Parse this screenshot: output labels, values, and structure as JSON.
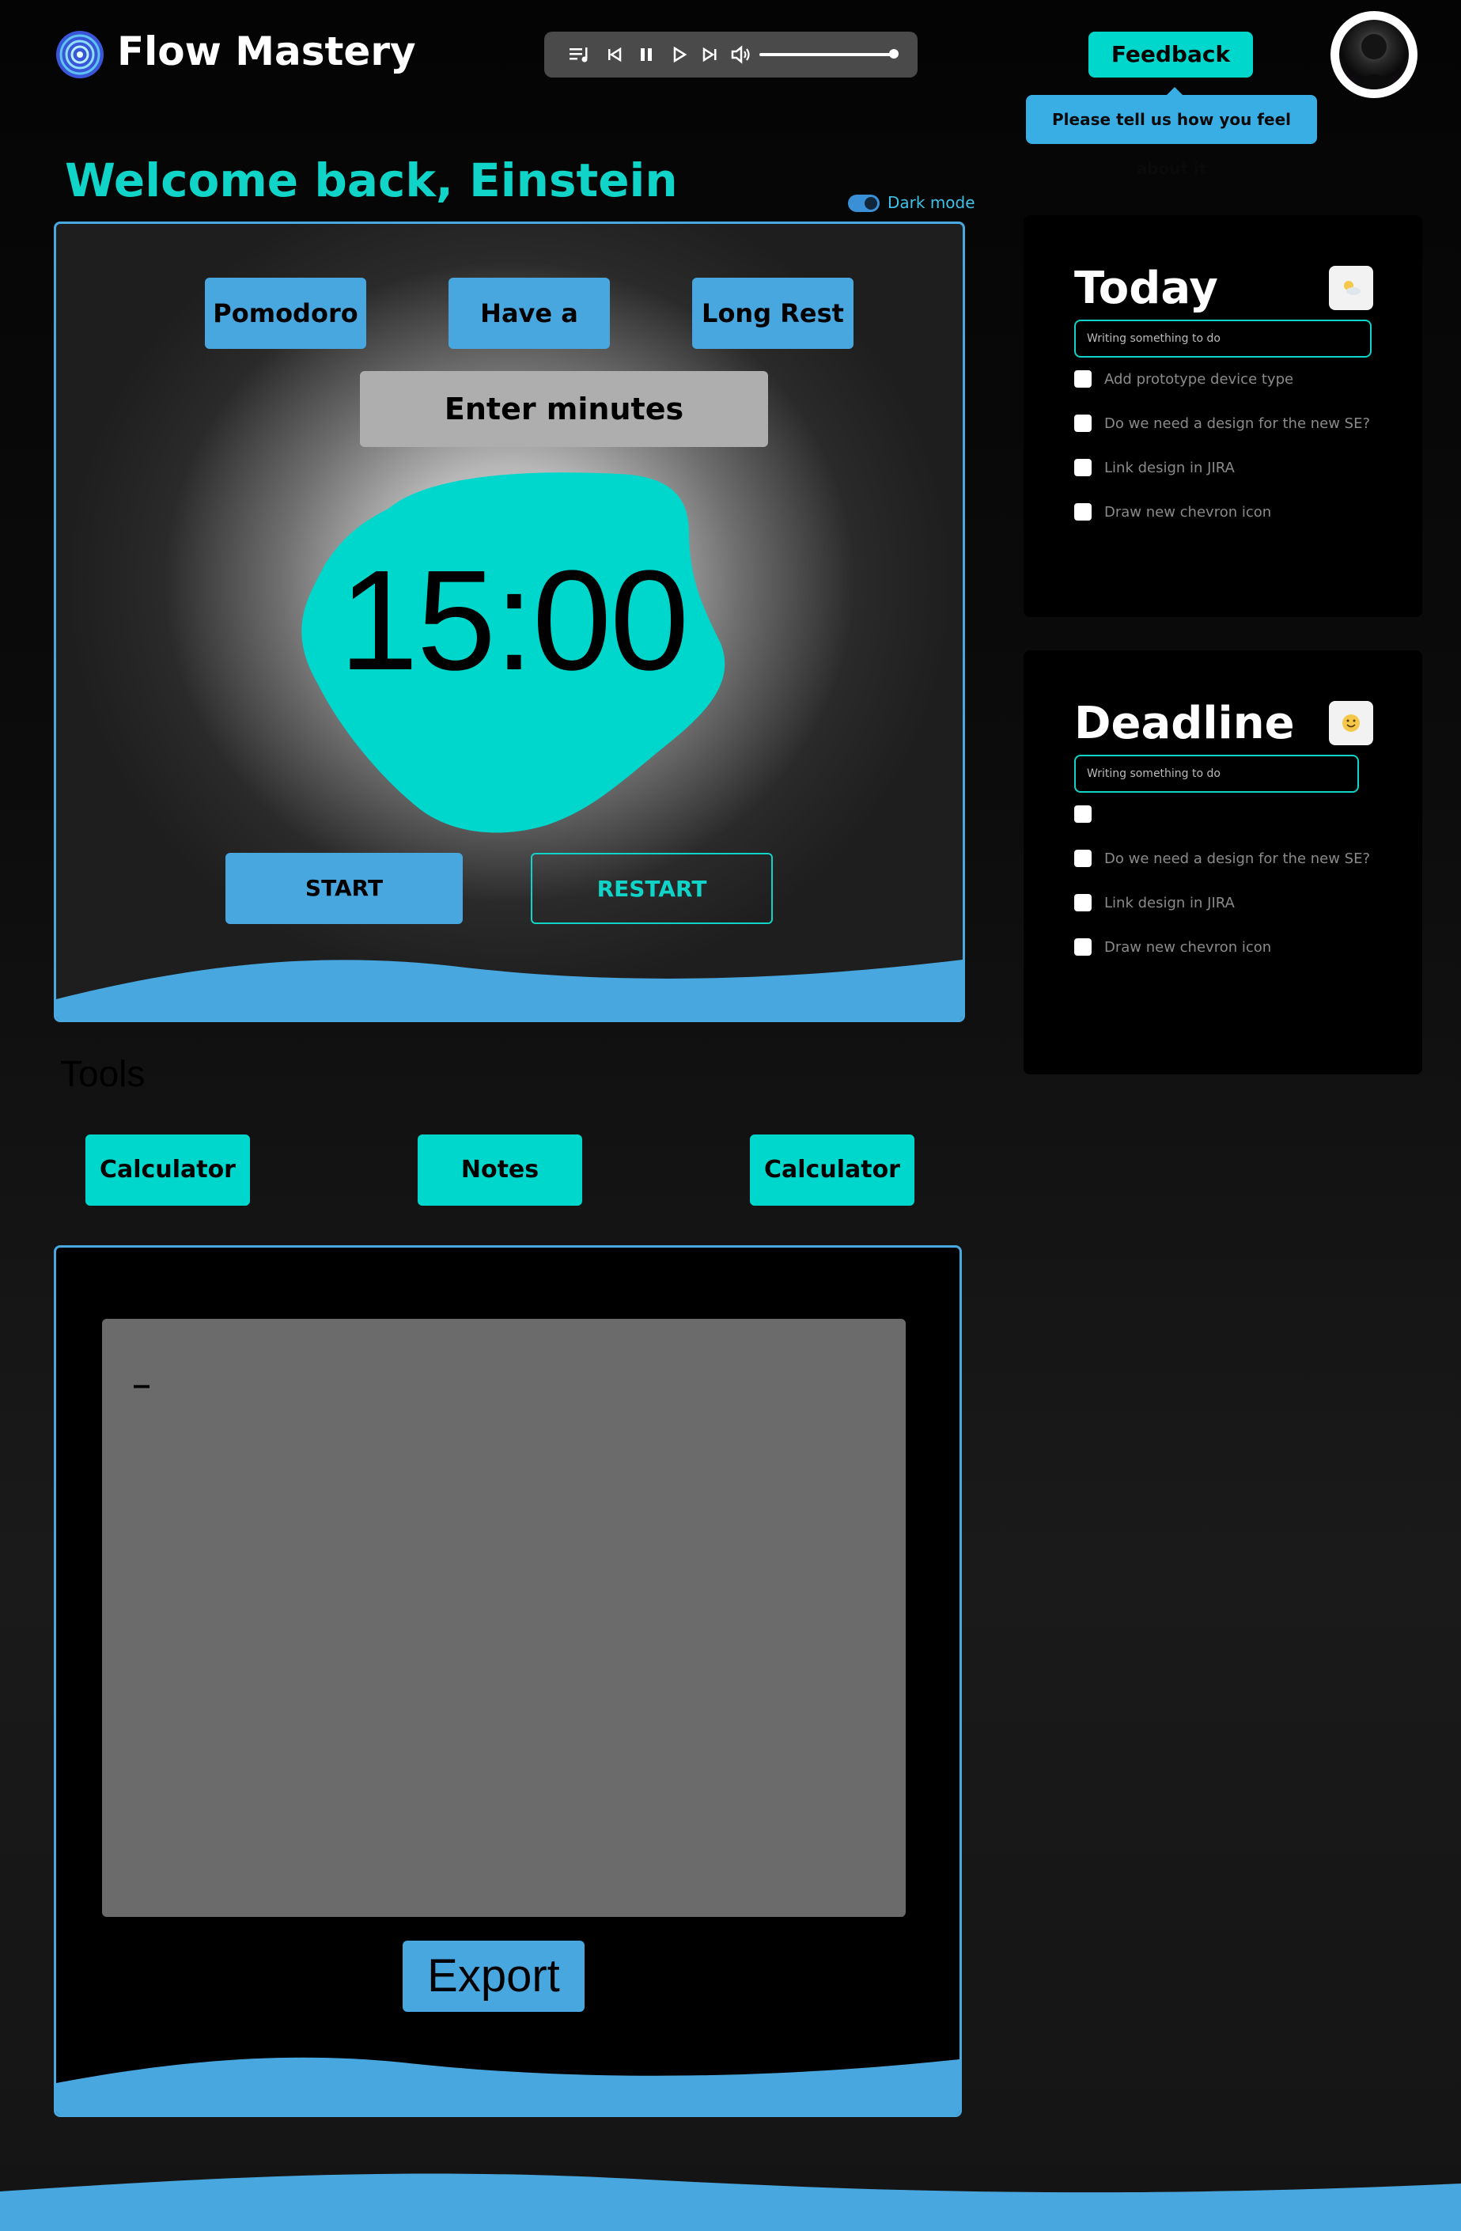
{
  "header": {
    "app_title": "Flow Mastery",
    "feedback_label": "Feedback",
    "feedback_tooltip": "Please tell us how you feel about it"
  },
  "player": {
    "controls": [
      "playlist-icon",
      "previous-icon",
      "pause-icon",
      "play-icon",
      "next-icon",
      "volume-icon"
    ],
    "volume_level": 1.0
  },
  "welcome": "Welcome back, Einstein",
  "dark_mode": {
    "label": "Dark mode",
    "enabled": true
  },
  "timer": {
    "modes": [
      "Pomodoro",
      "Have a rest",
      "Long Rest"
    ],
    "minutes_placeholder": "Enter minutes",
    "display": "15:00",
    "start_label": "START",
    "restart_label": "RESTART"
  },
  "tools": {
    "title": "Tools",
    "buttons": [
      "Calculator",
      "Notes",
      "Calculator"
    ]
  },
  "notes": {
    "content": "_",
    "export_label": "Export"
  },
  "today": {
    "title": "Today",
    "icon": "sun-cloud-icon",
    "input_placeholder": "Writing something to do",
    "tasks": [
      "Add prototype device type",
      "Do we need a design for the new SE?",
      "Link design in JIRA",
      "Draw new chevron icon"
    ]
  },
  "deadline": {
    "title": "Deadline",
    "icon": "smile-icon",
    "input_placeholder": "Writing something to do",
    "tasks": [
      "",
      "Do we need a design for the new SE?",
      "Link design in JIRA",
      "Draw new chevron icon"
    ]
  },
  "colors": {
    "accent_teal": "#00d7cc",
    "accent_blue": "#49a7e0",
    "background": "#0c0c0c"
  }
}
